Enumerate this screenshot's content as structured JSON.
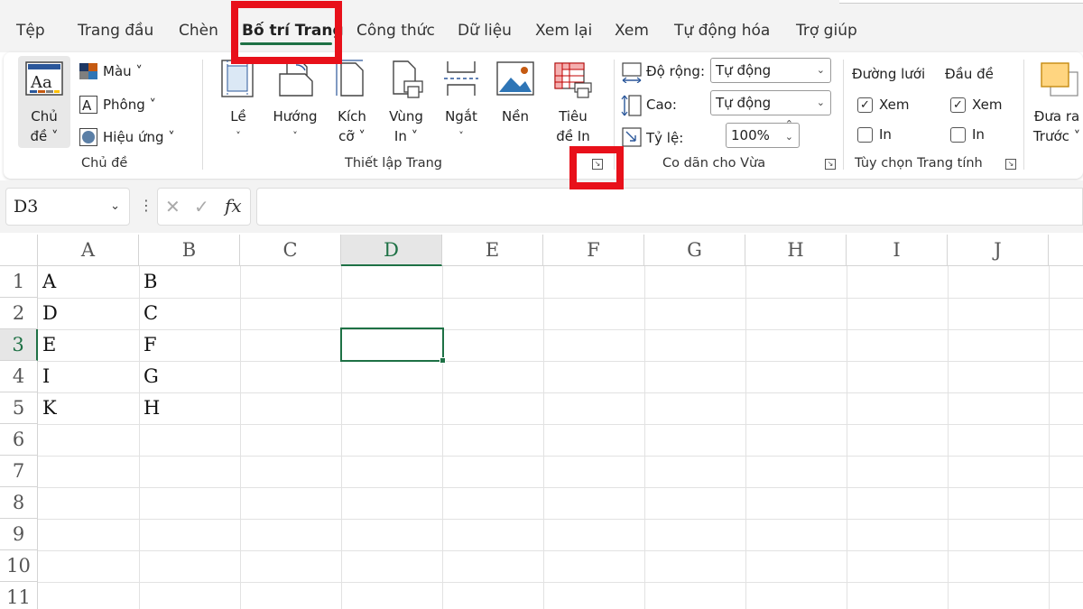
{
  "tabs": [
    "Tệp",
    "Trang đầu",
    "Chèn",
    "Bố trí Trang",
    "Công thức",
    "Dữ liệu",
    "Xem lại",
    "Xem",
    "Tự động hóa",
    "Trợ giúp"
  ],
  "active_tab": "Bố trí Trang",
  "ribbon": {
    "themes": {
      "theme_line1": "Chủ",
      "theme_line2": "đề ˅",
      "colors": "Màu ˅",
      "fonts": "Phông ˅",
      "effects": "Hiệu ứng ˅",
      "group_label": "Chủ đề"
    },
    "page_setup": {
      "margins": "Lề",
      "orientation": "Hướng",
      "size_line1": "Kích",
      "size_line2": "cỡ ˅",
      "print_area_line1": "Vùng",
      "print_area_line2": "In ˅",
      "breaks": "Ngắt",
      "background": "Nền",
      "print_titles_line1": "Tiêu",
      "print_titles_line2": "đề In",
      "chevron": "˅",
      "group_label": "Thiết lập Trang"
    },
    "scale_to_fit": {
      "width_label": "Độ rộng:",
      "width_value": "Tự động",
      "height_label": "Cao:",
      "height_value": "Tự động",
      "scale_label": "Tỷ lệ:",
      "scale_value": "100%",
      "group_label": "Co dãn cho Vừa"
    },
    "sheet_options": {
      "gridlines": "Đường lưới",
      "headings": "Đầu đề",
      "view": "Xem",
      "print": "In",
      "gridlines_view": true,
      "gridlines_print": false,
      "headings_view": true,
      "headings_print": false,
      "group_label": "Tùy chọn Trang tính"
    },
    "arrange": {
      "bring_forward_line1": "Đưa ra",
      "bring_forward_line2": "Trước ˅"
    }
  },
  "formula_bar": {
    "name_box": "D3",
    "fx": "fx",
    "value": ""
  },
  "sheet": {
    "columns": [
      "A",
      "B",
      "C",
      "D",
      "E",
      "F",
      "G",
      "H",
      "I",
      "J"
    ],
    "rows": [
      "1",
      "2",
      "3",
      "4",
      "5",
      "6",
      "7",
      "8",
      "9",
      "10",
      "11"
    ],
    "selected_cell": "D3",
    "cells": {
      "A1": "A",
      "B1": "B",
      "A2": "D",
      "B2": "C",
      "A3": "E",
      "B3": "F",
      "A4": "I",
      "B4": "G",
      "A5": "K",
      "B5": "H"
    }
  },
  "colors": {
    "accent_green": "#1e7145",
    "highlight_red": "#e8101a"
  }
}
